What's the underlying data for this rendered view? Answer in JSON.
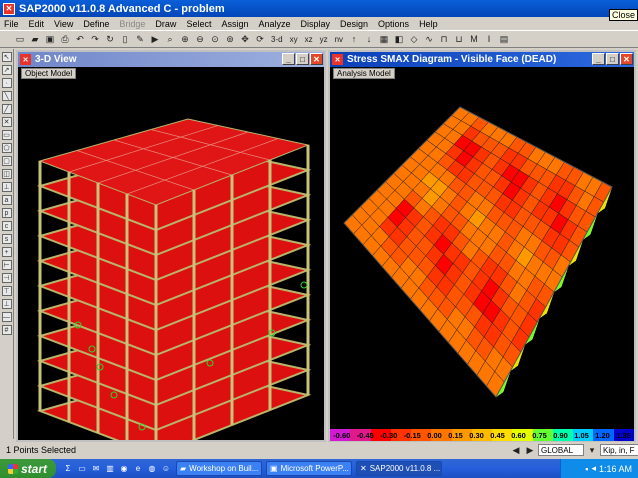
{
  "app": {
    "title": "SAP2000 v11.0.8 Advanced C  - problem",
    "close_tooltip": "Close"
  },
  "menu": [
    "File",
    "Edit",
    "View",
    "Define",
    "Bridge",
    "Draw",
    "Select",
    "Assign",
    "Analyze",
    "Display",
    "Design",
    "Options",
    "Help"
  ],
  "menu_disabled": [
    "Bridge"
  ],
  "toolbar": {
    "view_labels": [
      "3-d",
      "xy",
      "xz",
      "yz",
      "nv"
    ]
  },
  "left_window": {
    "title": "3-D View",
    "label": "Object Model"
  },
  "right_window": {
    "title": "Stress SMAX Diagram - Visible Face   (DEAD)",
    "label": "Analysis Model"
  },
  "legend": {
    "values": [
      "-0.60",
      "-0.45",
      "-0.30",
      "-0.15",
      "0.00",
      "0.15",
      "0.30",
      "0.45",
      "0.60",
      "0.75",
      "0.90",
      "1.05",
      "1.20",
      "1.35"
    ],
    "colors": [
      "#d21ad2",
      "#e01a8c",
      "#ff0000",
      "#ff3300",
      "#ff5500",
      "#ff7700",
      "#ff9900",
      "#ffbb00",
      "#ffdd00",
      "#e6ff00",
      "#66ff33",
      "#00ffaa",
      "#00ccff",
      "#0066ff",
      "#0000cc"
    ]
  },
  "status": {
    "text": "1 Points Selected",
    "coord_system": "GLOBAL",
    "units": "Kip, in, F"
  },
  "taskbar": {
    "start": "start",
    "tasks": [
      "Workshop on Buil...",
      "Microsoft PowerP...",
      "SAP2000 v11.0.8 ..."
    ],
    "active_task": "SAP2000 v11.0.8 ...",
    "clock": "1:16 AM"
  }
}
